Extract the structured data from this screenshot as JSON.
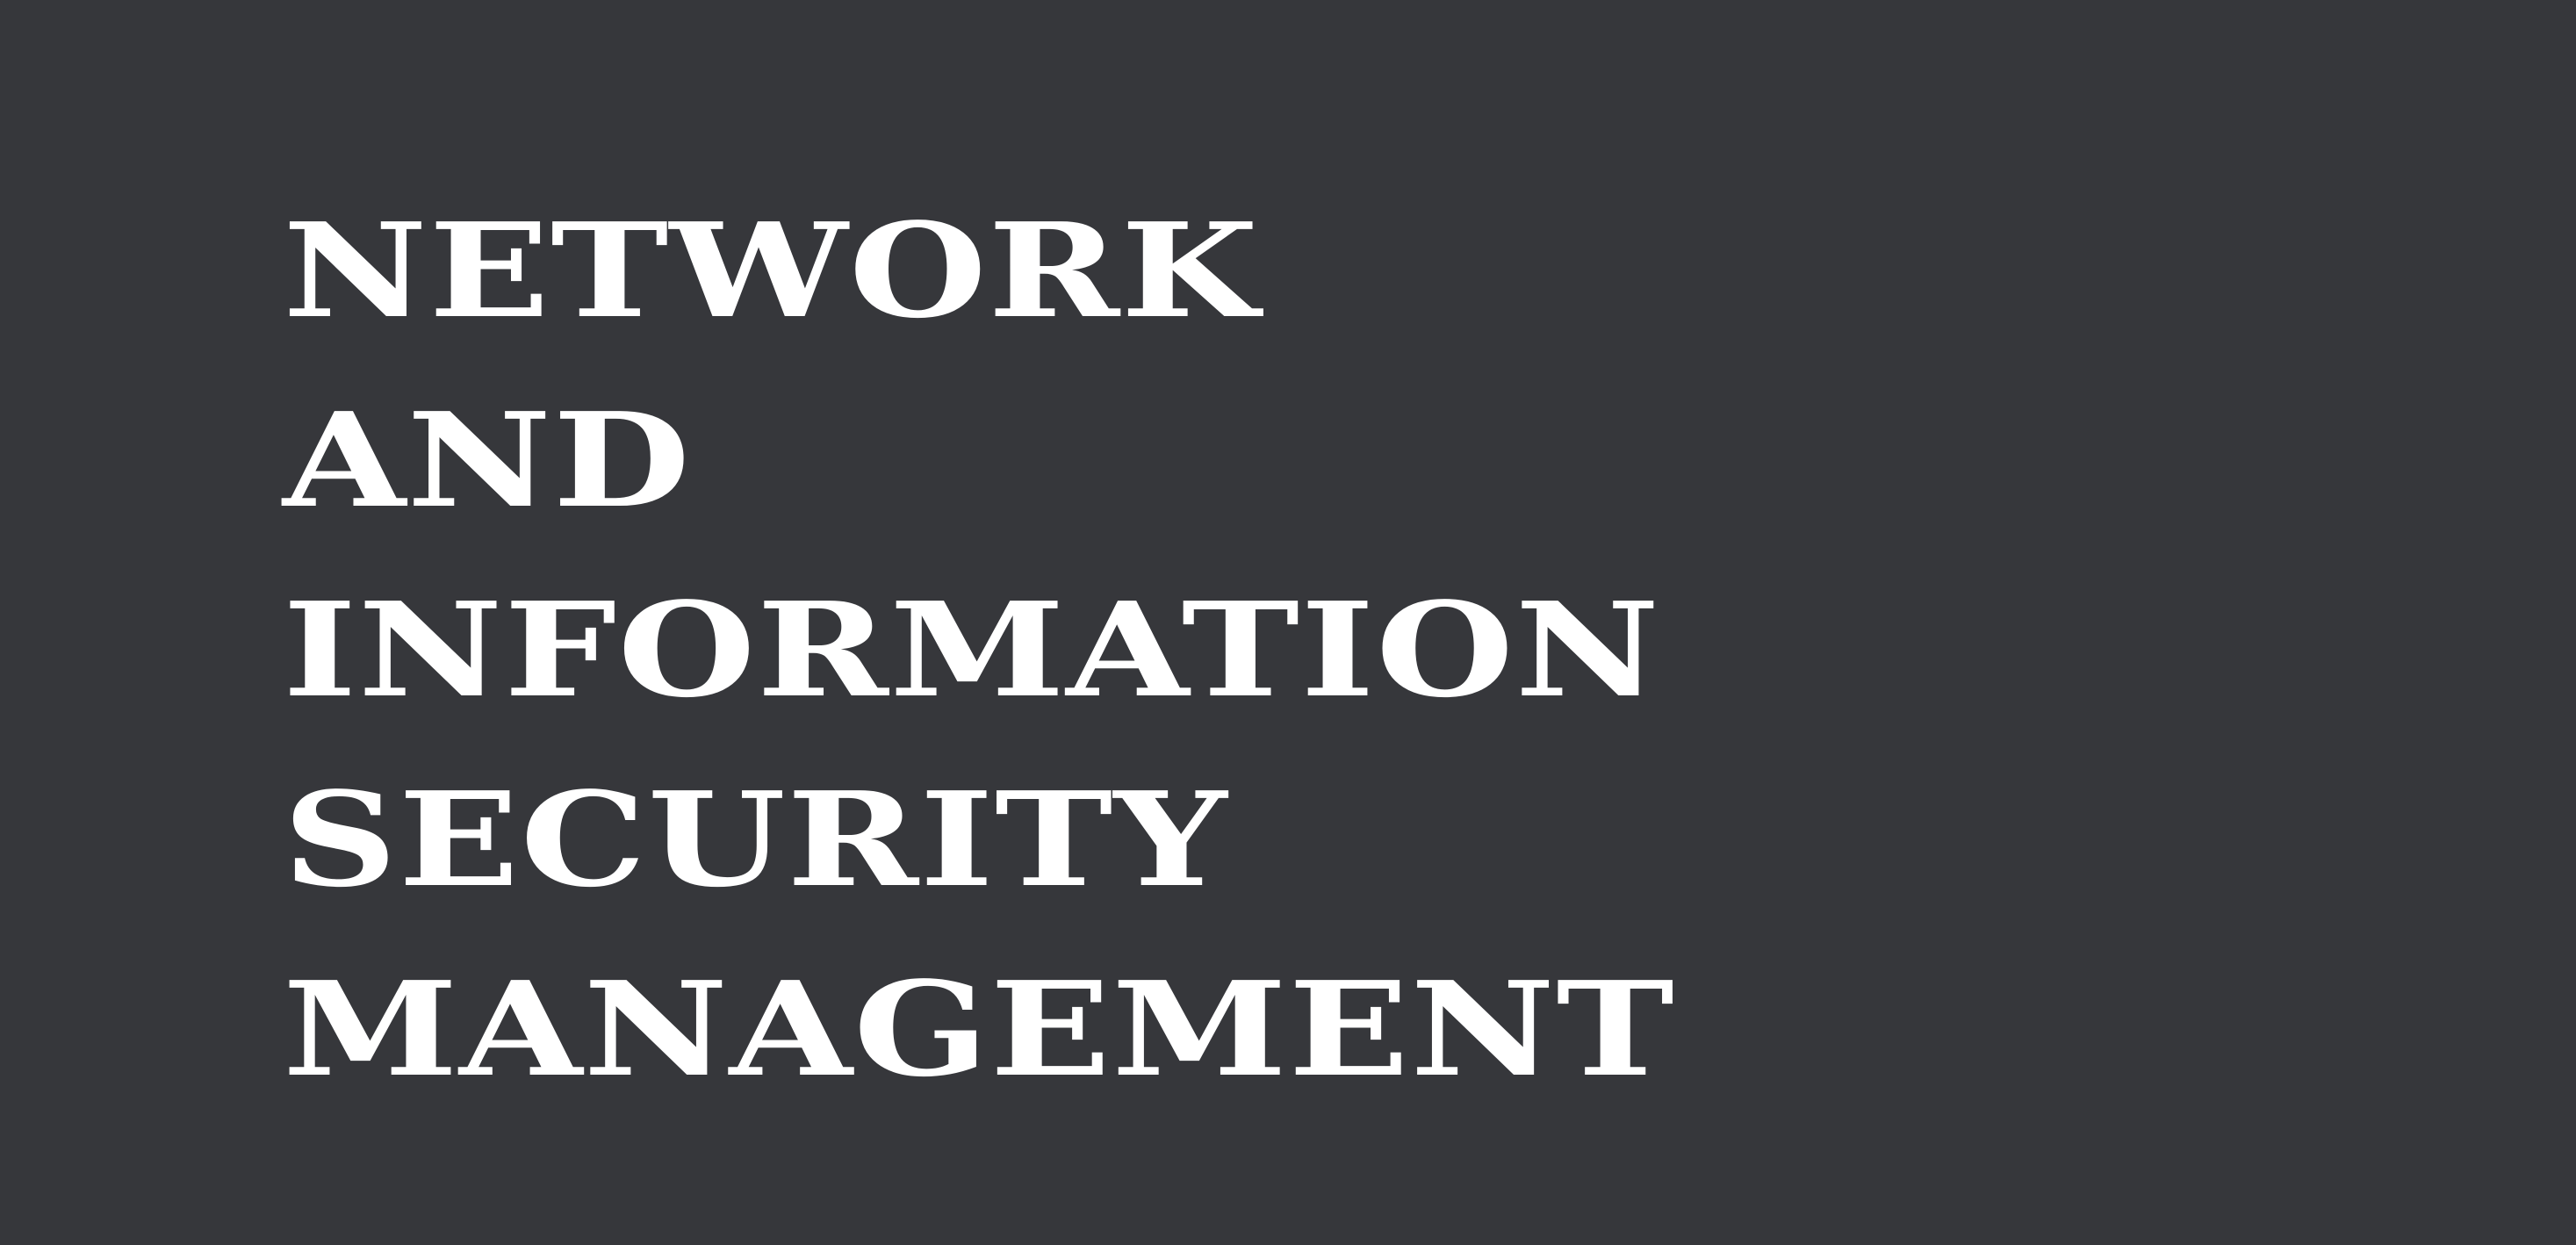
{
  "title_lines": [
    "NETWORK",
    "AND",
    "INFORMATION",
    "SECURITY",
    "MANAGEMENT"
  ],
  "colors": {
    "background": "#36373b",
    "text": "#ffffff"
  }
}
